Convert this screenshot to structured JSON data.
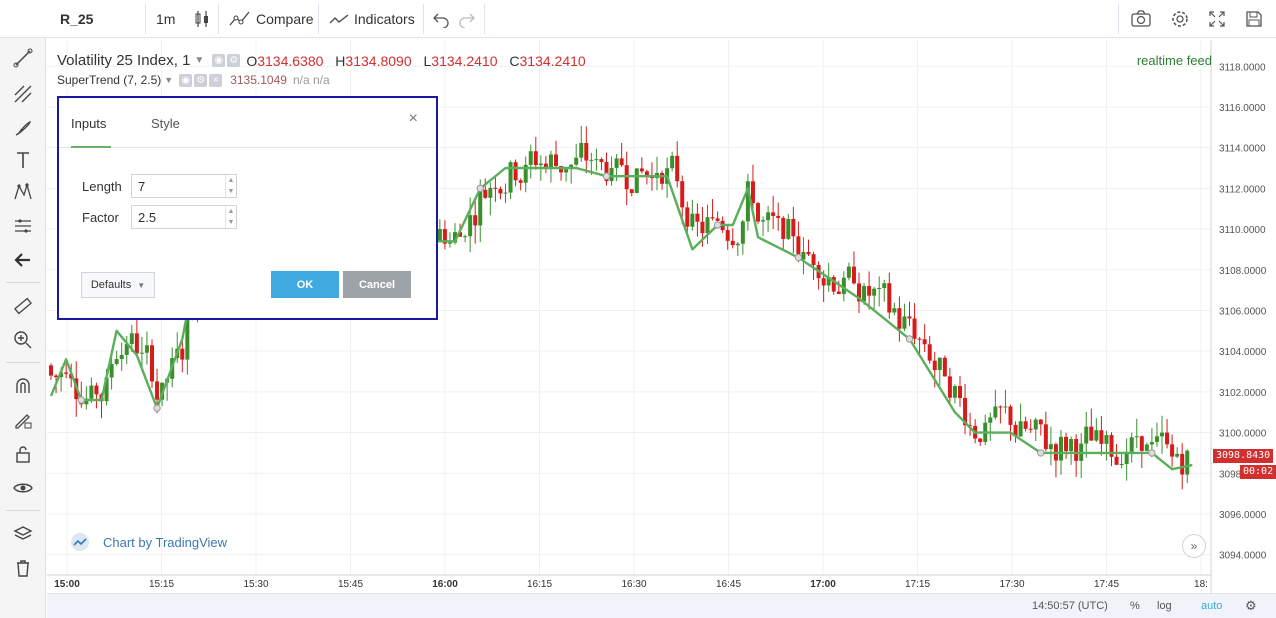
{
  "toolbar": {
    "symbol": "R_25",
    "interval": "1m",
    "compare_label": "Compare",
    "indicators_label": "Indicators"
  },
  "legend": {
    "title": "Volatility 25 Index, 1",
    "ohlc": {
      "o_label": "O",
      "o_value": "3134.6380",
      "h_label": "H",
      "h_value": "3134.8090",
      "l_label": "L",
      "l_value": "3134.2410",
      "c_label": "C",
      "c_value": "3134.2410"
    },
    "indicator_name": "SuperTrend (7, 2.5)",
    "indicator_value": "3135.1049",
    "indicator_na": "n/a  n/a"
  },
  "realtime_feed": "realtime feed",
  "watermark": "Chart by TradingView",
  "dialog": {
    "tabs": [
      "Inputs",
      "Style"
    ],
    "length_label": "Length",
    "length_value": "7",
    "factor_label": "Factor",
    "factor_value": "2.5",
    "defaults_label": "Defaults",
    "ok_label": "OK",
    "cancel_label": "Cancel"
  },
  "status": {
    "time": "14:50:57 (UTC)",
    "percent": "%",
    "log": "log",
    "auto": "auto"
  },
  "price_badges": {
    "last_price": "3098.8430",
    "countdown": "00:02"
  },
  "colors": {
    "up": "#3a8f2d",
    "down": "#d61b1b",
    "supertrend_down": "#a35a5a",
    "supertrend_up": "#5aaf5a",
    "accent": "#3fa9e0"
  },
  "chart_data": {
    "type": "candlestick",
    "x_ticks": [
      "15:00",
      "15:15",
      "15:30",
      "15:45",
      "16:00",
      "16:15",
      "16:30",
      "16:45",
      "17:00",
      "17:15",
      "17:30",
      "17:45",
      "18:"
    ],
    "y_ticks": [
      "3118.0000",
      "3116.0000",
      "3114.0000",
      "3112.0000",
      "3110.0000",
      "3108.0000",
      "3106.0000",
      "3104.0000",
      "3102.0000",
      "3100.0000",
      "3098.0000",
      "3096.0000",
      "3094.0000"
    ],
    "ylim": [
      3093.0,
      3118.8
    ],
    "series": [
      {
        "name": "SuperTrend (7, 2.5)",
        "x_minutes": [
          0,
          3,
          6,
          10,
          13,
          17,
          21,
          26,
          31,
          36,
          40,
          46,
          52,
          58,
          62,
          67,
          74,
          80,
          85,
          90,
          98,
          104,
          110,
          116,
          122,
          127,
          132,
          135,
          138,
          140,
          148,
          154,
          160,
          165,
          170,
          179,
          183,
          190,
          196,
          201,
          207,
          212,
          218,
          222,
          226
        ],
        "values": [
          3101.8,
          3103.6,
          3101.6,
          3101.6,
          3105.0,
          3103.8,
          3101.2,
          3104.6,
          3111.0,
          3111.0,
          3112.0,
          3111.4,
          3111.0,
          3111.0,
          3110.6,
          3110.2,
          3109.4,
          3109.4,
          3112.0,
          3113.0,
          3113.0,
          3113.0,
          3112.6,
          3112.6,
          3112.6,
          3109.0,
          3110.2,
          3110.2,
          3112.0,
          3109.6,
          3108.6,
          3107.6,
          3106.6,
          3105.6,
          3104.6,
          3101.0,
          3100.0,
          3100.0,
          3099.0,
          3099.0,
          3099.0,
          3099.0,
          3099.0,
          3098.2,
          3098.4
        ]
      }
    ]
  }
}
